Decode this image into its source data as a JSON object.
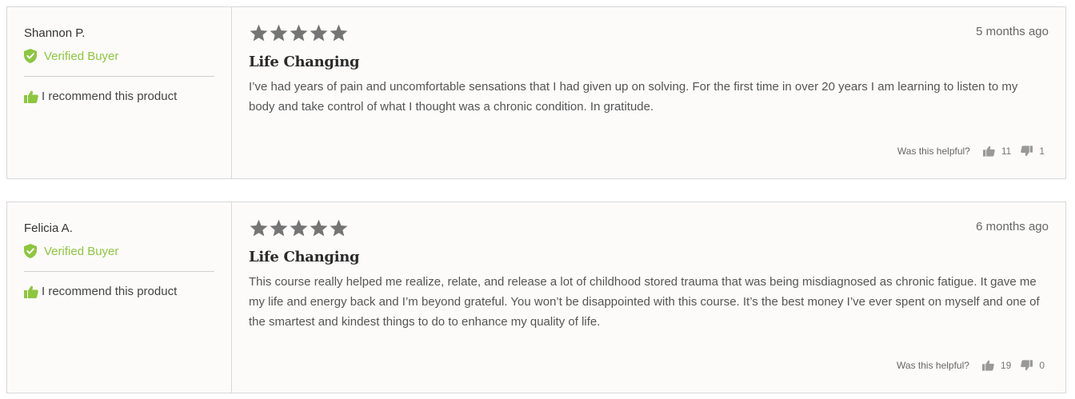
{
  "colors": {
    "verified": "#8dc63f",
    "star": "#757575",
    "thumb": "#999999"
  },
  "reviews": [
    {
      "author": "Shannon P.",
      "verified_label": "Verified Buyer",
      "recommend_label": "I recommend this product",
      "rating": 5,
      "date": "5 months ago",
      "title": "Life Changing",
      "body": "I’ve had years of pain and uncomfortable sensations that I had given up on solving. For the first time in over 20 years I am learning to listen to my body and take control of what I thought was a chronic condition. In gratitude.",
      "helpful_label": "Was this helpful?",
      "helpful_yes": "11",
      "helpful_no": "1"
    },
    {
      "author": "Felicia A.",
      "verified_label": "Verified Buyer",
      "recommend_label": "I recommend this product",
      "rating": 5,
      "date": "6 months ago",
      "title": "Life Changing",
      "body": "This course really helped me realize, relate, and release a lot of childhood stored trauma that was being misdiagnosed as chronic fatigue. It gave me my life and energy back and I’m beyond grateful. You won’t be disappointed with this course. It’s the best money I’ve ever spent on myself and one of the smartest and kindest things to do to enhance my quality of life.",
      "helpful_label": "Was this helpful?",
      "helpful_yes": "19",
      "helpful_no": "0"
    }
  ]
}
